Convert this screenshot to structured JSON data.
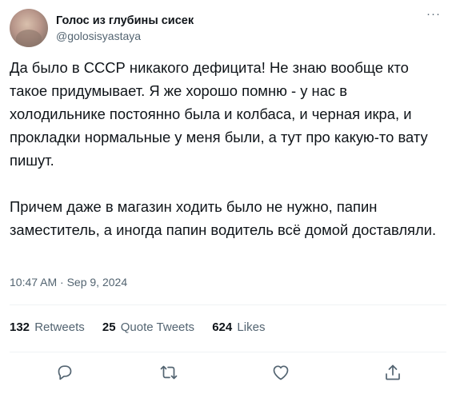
{
  "author": {
    "display_name": "Голос из глубины сисек",
    "handle": "@golosisyastaya"
  },
  "tweet": {
    "paragraphs": [
      "Да было в СССР никакого дефицита! Не знаю вообще кто такое придумывает. Я же хорошо помню - у нас в холодильнике постоянно была и колбаса, и черная икра, и прокладки нормальные у меня были, а тут про какую-то вату пишут.",
      "Причем даже в магазин ходить было не нужно, папин заместитель, а иногда папин водитель всё домой доставляли."
    ],
    "timestamp": "10:47 AM · Sep 9, 2024"
  },
  "stats": {
    "retweets_count": "132",
    "retweets_label": "Retweets",
    "quotes_count": "25",
    "quotes_label": "Quote Tweets",
    "likes_count": "624",
    "likes_label": "Likes"
  },
  "more_glyph": "···",
  "icons": {
    "reply": "reply-icon",
    "retweet": "retweet-icon",
    "like": "heart-icon",
    "share": "share-icon",
    "more": "more-icon"
  },
  "colors": {
    "text": "#0f1419",
    "secondary": "#536471",
    "divider": "#eff3f4"
  }
}
